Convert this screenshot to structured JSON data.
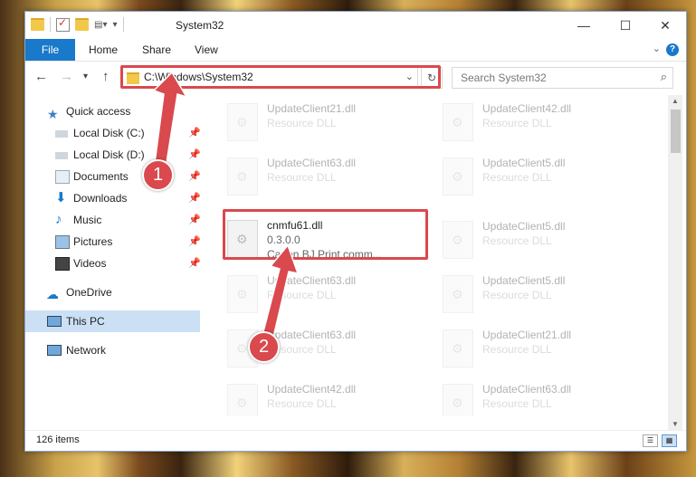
{
  "window": {
    "title": "System32"
  },
  "ribbon": {
    "file": "File",
    "tabs": [
      "Home",
      "Share",
      "View"
    ],
    "help": "?"
  },
  "nav": {
    "back": "←",
    "forward": "→",
    "recent": "▾",
    "up": "↑"
  },
  "address": {
    "path": "C:\\Windows\\System32"
  },
  "search": {
    "placeholder": "Search System32"
  },
  "sidebar": {
    "items": [
      {
        "label": "Quick access",
        "icon": "star-icon"
      },
      {
        "label": "Local Disk (C:)",
        "icon": "drive-icon"
      },
      {
        "label": "Local Disk (D:)",
        "icon": "drive-icon"
      },
      {
        "label": "Documents",
        "icon": "documents-icon"
      },
      {
        "label": "Downloads",
        "icon": "download-icon"
      },
      {
        "label": "Music",
        "icon": "music-icon"
      },
      {
        "label": "Pictures",
        "icon": "pictures-icon"
      },
      {
        "label": "Videos",
        "icon": "videos-icon"
      },
      {
        "label": "OneDrive",
        "icon": "cloud-icon"
      },
      {
        "label": "This PC",
        "icon": "computer-icon"
      },
      {
        "label": "Network",
        "icon": "network-icon"
      }
    ]
  },
  "files": {
    "left": [
      {
        "name": "UpdateClient21.dll",
        "desc": "Resource DLL"
      },
      {
        "name": "UpdateClient63.dll",
        "desc": "Resource DLL"
      },
      {
        "name": "UpdateClient63.dll",
        "desc": "Resource DLL"
      },
      {
        "name": "UpdateClient63.dll",
        "desc": "Resource DLL"
      },
      {
        "name": "UpdateClient42.dll",
        "desc": "Resource DLL"
      }
    ],
    "right": [
      {
        "name": "UpdateClient42.dll",
        "desc": "Resource DLL"
      },
      {
        "name": "UpdateClient5.dll",
        "desc": "Resource DLL"
      },
      {
        "name": "UpdateClient5.dll",
        "desc": "Resource DLL"
      },
      {
        "name": "UpdateClient5.dll",
        "desc": "Resource DLL"
      },
      {
        "name": "UpdateClient21.dll",
        "desc": "Resource DLL"
      },
      {
        "name": "UpdateClient63.dll",
        "desc": "Resource DLL"
      }
    ],
    "highlighted": {
      "name": "cnmfu61.dll",
      "version": "0.3.0.0",
      "desc": "Canon BJ Print comm..."
    }
  },
  "status": {
    "count": "126 items"
  },
  "callouts": [
    "1",
    "2"
  ],
  "colors": {
    "accent": "#1979ca",
    "highlight": "#d9494d"
  }
}
